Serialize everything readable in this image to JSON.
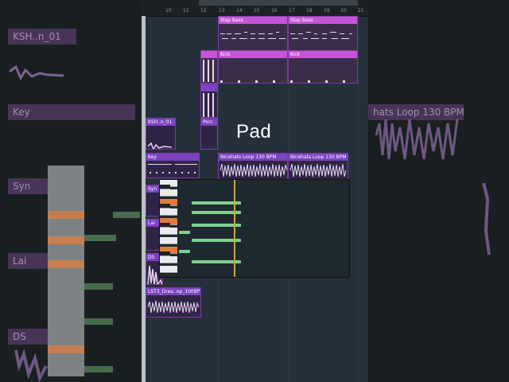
{
  "caption": "Pad",
  "ruler": {
    "numbers": [
      "10",
      "11",
      "12",
      "13",
      "14",
      "15",
      "16",
      "17",
      "18",
      "19",
      "20",
      "21"
    ]
  },
  "background_left": {
    "labels": [
      "KSH..n_01",
      "Key",
      "Syn",
      "Lai",
      "DS"
    ]
  },
  "background_right": {
    "labels": [
      "hats Loop 130 BPM"
    ]
  },
  "clips": {
    "slap_bass_1": "Slap Bass",
    "slap_bass_2": "Slap Bass",
    "kick_1": "Kick",
    "kick_2": "Kick",
    "ksh": "KSH..n_01",
    "perc": "Perc",
    "key": "Key",
    "nicehats_1": "Nicehats Loop 130 BPM",
    "nicehats_2": "Nicehats Loop 130 BPM",
    "syn": "Syn",
    "lai": "Lai",
    "ds": "DS",
    "lst": "LST3_Drea..op_100BPM"
  },
  "colors": {
    "pink": "#c456d6",
    "violet": "#7a43c0",
    "note": "#7fd08f",
    "playhead": "#c7a63a"
  }
}
